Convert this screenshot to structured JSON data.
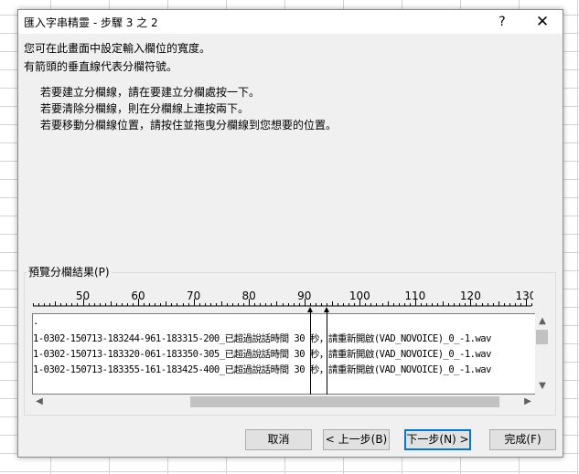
{
  "window": {
    "title": "匯入字串精靈 - 步驟 3 之 2",
    "help_label": "?",
    "close_label": "✕"
  },
  "intro": {
    "line1": "您可在此畫面中設定輸入欄位的寬度。",
    "line2": "有箭頭的垂直線代表分欄符號。"
  },
  "instructions": [
    "若要建立分欄線，請在要建立分欄處按一下。",
    "若要清除分欄線，則在分欄線上連按兩下。",
    "若要移動分欄線位置，請按住並拖曳分欄線到您想要的位置。"
  ],
  "preview": {
    "group_label": "預覽分欄結果(P)",
    "ruler_start": 41,
    "ruler_end": 131,
    "ruler_labels": [
      "50",
      "60",
      "70",
      "80",
      "90",
      "100",
      "110",
      "120",
      "130"
    ],
    "column_breaks": [
      91,
      94
    ],
    "lines": [
      ".",
      "1-0302-150713-183244-961-183315-200_已超過說話時間 30 秒，請重新開啟(VAD_NOVOICE)_0_-1.wav",
      "1-0302-150713-183320-061-183350-305_已超過說話時間 30 秒，請重新開啟(VAD_NOVOICE)_0_-1.wav",
      "1-0302-150713-183355-161-183425-400_已超過說話時間 30 秒，請重新開啟(VAD_NOVOICE)_0_-1.wav"
    ]
  },
  "scroll": {
    "up": "▲",
    "down": "▼",
    "left": "◀",
    "right": "▶"
  },
  "buttons": {
    "cancel": "取消",
    "back": "< 上一步(B)",
    "next": "下一步(N) >",
    "finish": "完成(F)"
  }
}
